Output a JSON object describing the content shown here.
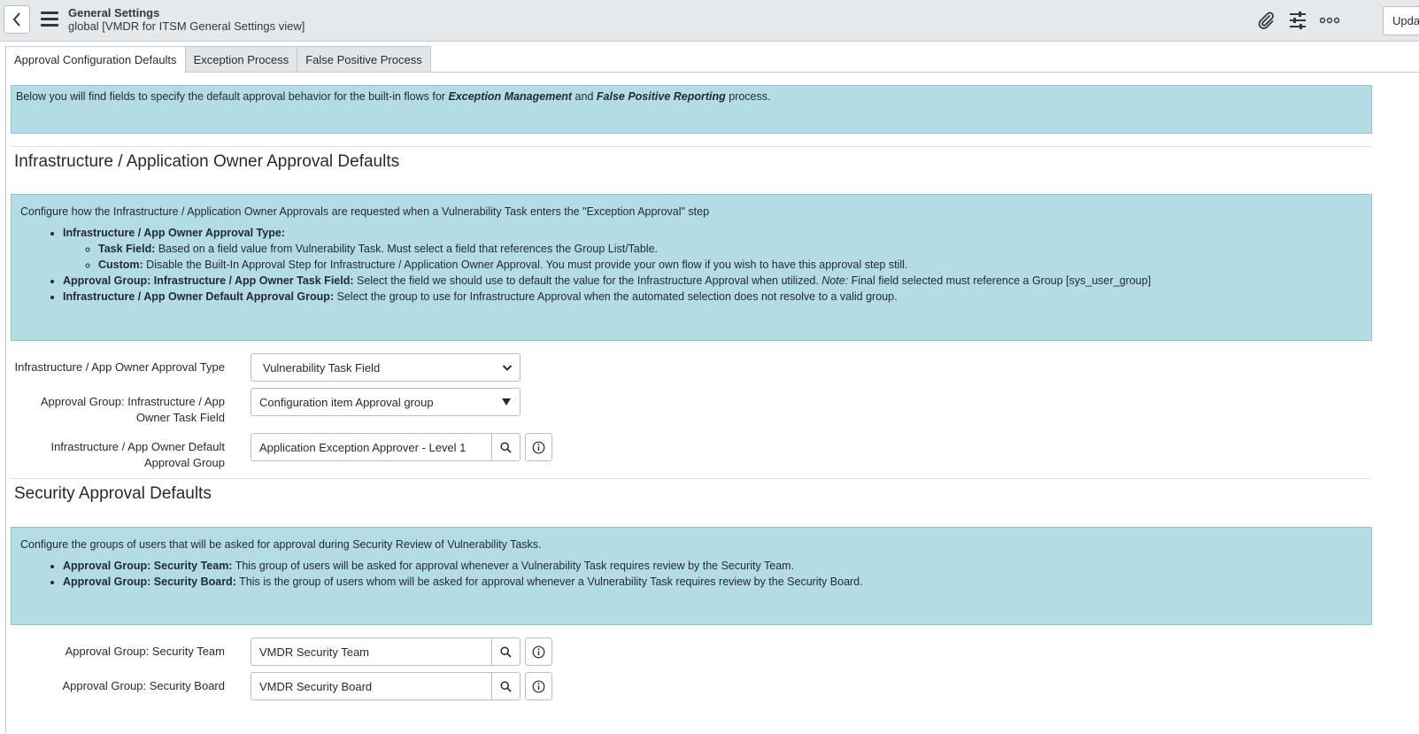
{
  "header": {
    "title": "General Settings",
    "subtitle": "global [VMDR for ITSM General Settings view]",
    "update_label": "Updat"
  },
  "tabs": [
    {
      "label": "Approval Configuration Defaults",
      "active": true
    },
    {
      "label": "Exception Process",
      "active": false
    },
    {
      "label": "False Positive Process",
      "active": false
    }
  ],
  "intro": {
    "text1": "Below you will find fields to specify the default approval behavior for the built-in flows for ",
    "em1": "Exception Management",
    "text2": " and ",
    "em2": "False Positive Reporting",
    "text3": " process."
  },
  "infra_section": {
    "title": "Infrastructure / Application Owner Approval Defaults",
    "info_intro": "Configure how the Infrastructure / Application Owner Approvals are requested when a Vulnerability Task enters the \"Exception Approval\" step",
    "bullet1_label": "Infrastructure / App Owner Approval Type:",
    "sub1_label": "Task Field:",
    "sub1_text": " Based on a field value from Vulnerability Task. Must select a field that references the Group List/Table.",
    "sub2_label": "Custom:",
    "sub2_text": " Disable the Built-In Approval Step for Infrastructure / Application Owner Approval. You must provide your own flow if you wish to have this approval step still.",
    "bullet2_label": "Approval Group: Infrastructure / App Owner Task Field:",
    "bullet2_text": " Select the field we should use to default the value for the Infrastructure Approval when utilized. ",
    "bullet2_note": "Note:",
    "bullet2_text2": " Final field selected must reference a Group [sys_user_group]",
    "bullet3_label": "Infrastructure / App Owner Default Approval Group:",
    "bullet3_text": " Select the group to use for Infrastructure Approval when the automated selection does not resolve to a valid group.",
    "fields": {
      "approval_type_label": "Infrastructure / App Owner Approval Type",
      "approval_type_value": "Vulnerability Task Field",
      "task_field_label": "Approval Group: Infrastructure / App Owner Task Field",
      "task_field_value": "Configuration item Approval group",
      "default_group_label": "Infrastructure / App Owner Default Approval Group",
      "default_group_value": "Application Exception Approver - Level 1"
    }
  },
  "security_section": {
    "title": "Security Approval Defaults",
    "info_intro": "Configure the groups of users that will be asked for approval during Security Review of Vulnerability Tasks.",
    "bullet1_label": "Approval Group: Security Team:",
    "bullet1_text": " This group of users will be asked for approval whenever a Vulnerability Task requires review by the Security Team.",
    "bullet2_label": "Approval Group: Security Board:",
    "bullet2_text": " This is the group of users whom will be asked for approval whenever a Vulnerability Task requires review by the Security Board.",
    "fields": {
      "team_label": "Approval Group: Security Team",
      "team_value": "VMDR Security Team",
      "board_label": "Approval Group: Security Board",
      "board_value": "VMDR Security Board"
    }
  },
  "icons": [
    "back-arrow-icon",
    "hamburger-menu-icon",
    "paperclip-icon",
    "settings-sliders-icon",
    "more-options-icon",
    "chevron-down-icon",
    "triangle-down-icon",
    "search-icon",
    "info-icon"
  ]
}
